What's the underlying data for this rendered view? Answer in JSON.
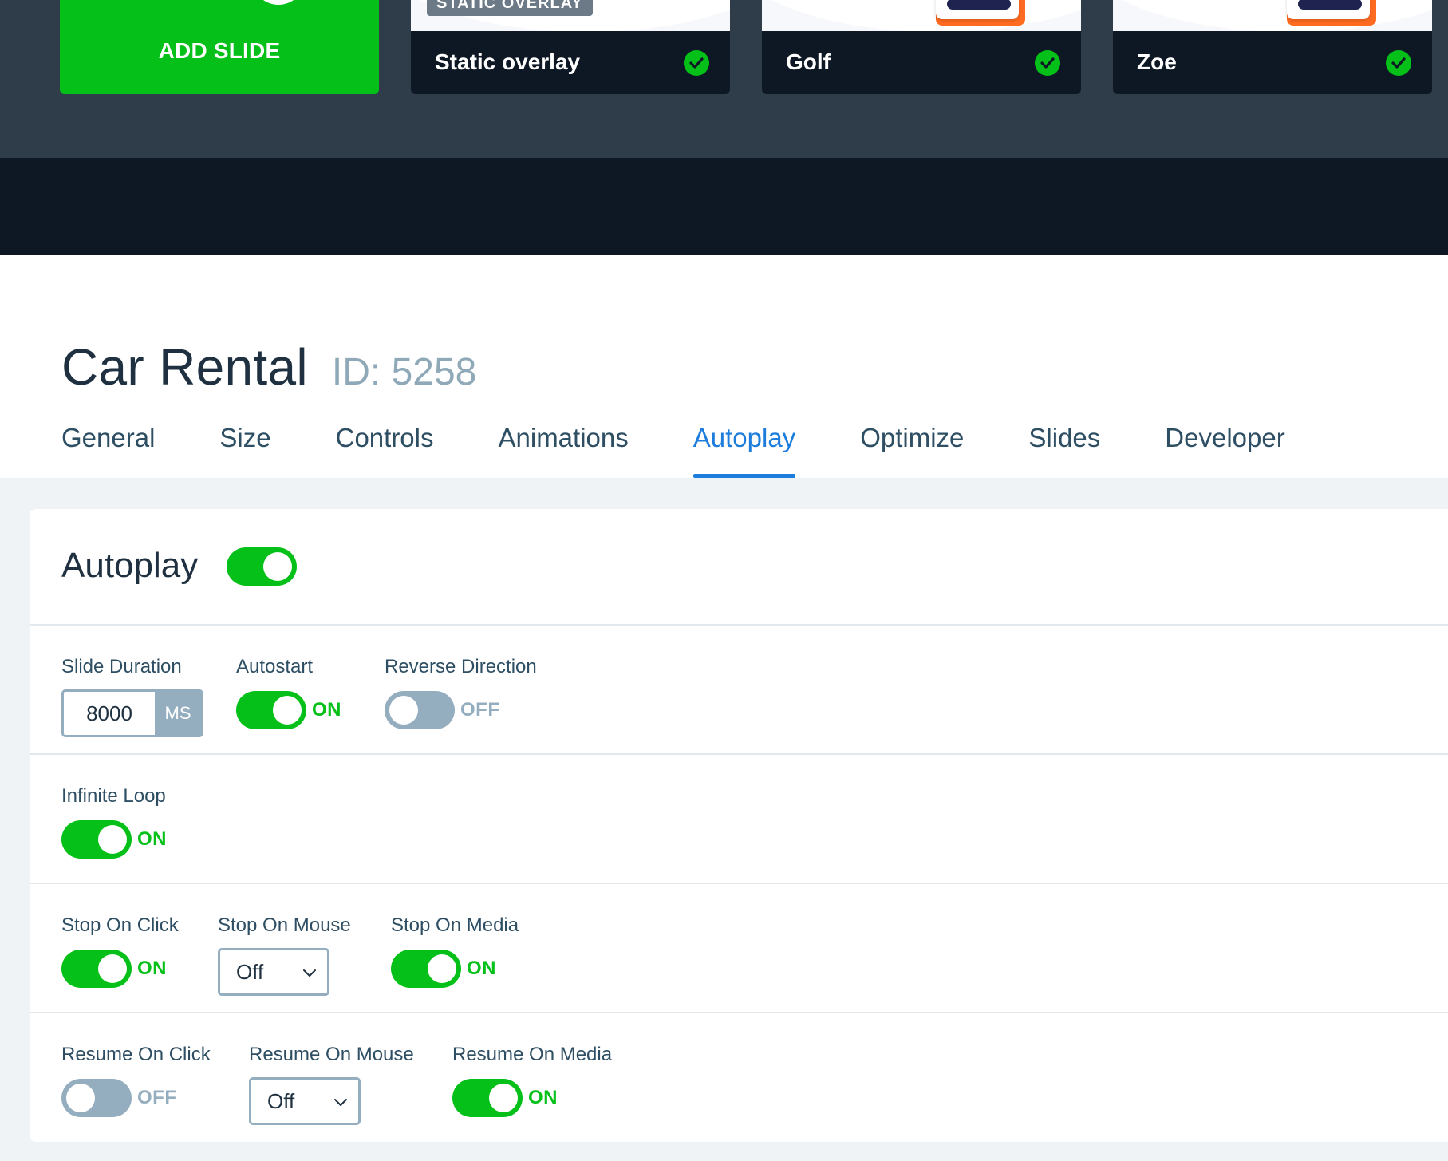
{
  "slides": {
    "add_label": "ADD SLIDE",
    "items": [
      {
        "name": "Static overlay",
        "tag": "STATIC OVERLAY"
      },
      {
        "name": "Golf"
      },
      {
        "name": "Zoe"
      }
    ]
  },
  "header": {
    "title": "Car Rental",
    "id_label": "ID: 5258",
    "tabs": [
      "General",
      "Size",
      "Controls",
      "Animations",
      "Autoplay",
      "Optimize",
      "Slides",
      "Developer"
    ],
    "active_tab": "Autoplay"
  },
  "panel": {
    "title": "Autoplay",
    "enabled": true,
    "slide_duration": {
      "label": "Slide Duration",
      "value": "8000",
      "unit": "MS"
    },
    "autostart": {
      "label": "Autostart",
      "state": "ON"
    },
    "reverse_direction": {
      "label": "Reverse Direction",
      "state": "OFF"
    },
    "infinite_loop": {
      "label": "Infinite Loop",
      "state": "ON"
    },
    "stop_on_click": {
      "label": "Stop On Click",
      "state": "ON"
    },
    "stop_on_mouse": {
      "label": "Stop On Mouse",
      "value": "Off"
    },
    "stop_on_media": {
      "label": "Stop On Media",
      "state": "ON"
    },
    "resume_on_click": {
      "label": "Resume On Click",
      "state": "OFF"
    },
    "resume_on_mouse": {
      "label": "Resume On Mouse",
      "value": "Off"
    },
    "resume_on_media": {
      "label": "Resume On Media",
      "state": "ON"
    }
  },
  "colors": {
    "accent_green": "#04c018",
    "accent_blue": "#1d7ddc",
    "toggle_off": "#94aebf",
    "bar_bg": "#2e3d49",
    "bar_dark": "#0e1824"
  },
  "icons": {
    "check": "check-circle-icon",
    "chevron": "chevron-down-icon",
    "plus": "plus-icon"
  }
}
